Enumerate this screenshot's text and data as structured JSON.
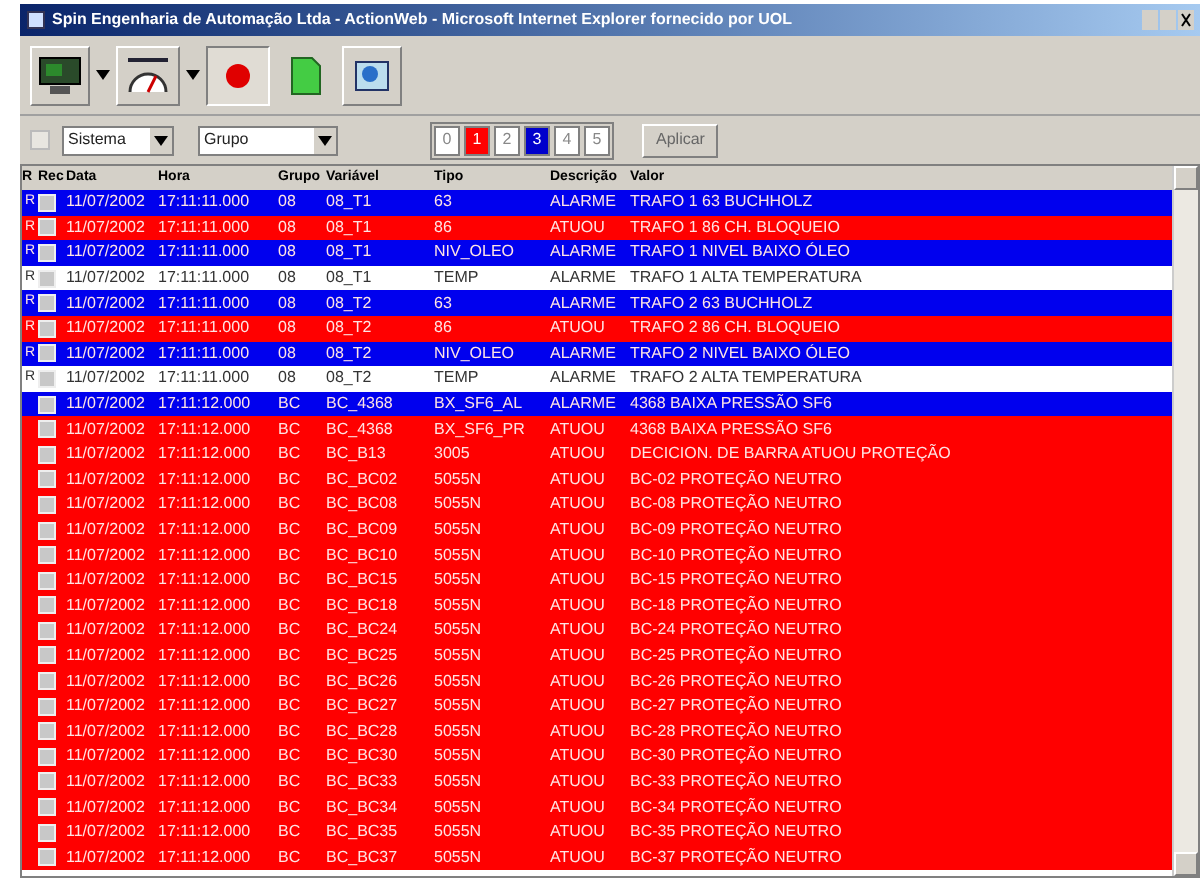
{
  "window": {
    "title": "Spin Engenharia de Automação Ltda - ActionWeb - Microsoft Internet Explorer fornecido por UOL"
  },
  "filters": {
    "checked": false,
    "sistema": "Sistema",
    "grupo": "Grupo",
    "button": "Aplicar"
  },
  "priorities": [
    {
      "label": "0",
      "color": "#ffffff"
    },
    {
      "label": "1",
      "color": "#ff0000"
    },
    {
      "label": "2",
      "color": "#ffffff"
    },
    {
      "label": "3",
      "color": "#0000cc"
    },
    {
      "label": "4",
      "color": "#ffffff"
    },
    {
      "label": "5",
      "color": "#ffffff"
    }
  ],
  "table": {
    "columns": [
      "R",
      "Rec",
      "Data",
      "Hora",
      "Grupo",
      "Variável",
      "Tipo",
      "Descrição",
      "Valor"
    ],
    "rows": [
      {
        "color": "#0000ee",
        "flag": "R",
        "data": "11/07/2002",
        "hora": "17:11:11.000",
        "grupo": "08",
        "variavel": "08_T1",
        "tipo": "63",
        "descricao": "ALARME",
        "valor": "TRAFO 1 63 BUCHHOLZ"
      },
      {
        "color": "#ff0000",
        "flag": "R",
        "data": "11/07/2002",
        "hora": "17:11:11.000",
        "grupo": "08",
        "variavel": "08_T1",
        "tipo": "86",
        "descricao": "ATUOU",
        "valor": "TRAFO 1 86 CH. BLOQUEIO"
      },
      {
        "color": "#0000ee",
        "flag": "R",
        "data": "11/07/2002",
        "hora": "17:11:11.000",
        "grupo": "08",
        "variavel": "08_T1",
        "tipo": "NIV_OLEO",
        "descricao": "ALARME",
        "valor": "TRAFO 1 NIVEL BAIXO ÓLEO"
      },
      {
        "color": "#ffffff",
        "flag": "R",
        "data": "11/07/2002",
        "hora": "17:11:11.000",
        "grupo": "08",
        "variavel": "08_T1",
        "tipo": "TEMP",
        "descricao": "ALARME",
        "valor": "TRAFO 1 ALTA TEMPERATURA"
      },
      {
        "color": "#0000ee",
        "flag": "R",
        "data": "11/07/2002",
        "hora": "17:11:11.000",
        "grupo": "08",
        "variavel": "08_T2",
        "tipo": "63",
        "descricao": "ALARME",
        "valor": "TRAFO 2 63 BUCHHOLZ"
      },
      {
        "color": "#ff0000",
        "flag": "R",
        "data": "11/07/2002",
        "hora": "17:11:11.000",
        "grupo": "08",
        "variavel": "08_T2",
        "tipo": "86",
        "descricao": "ATUOU",
        "valor": "TRAFO 2 86 CH. BLOQUEIO"
      },
      {
        "color": "#0000ee",
        "flag": "R",
        "data": "11/07/2002",
        "hora": "17:11:11.000",
        "grupo": "08",
        "variavel": "08_T2",
        "tipo": "NIV_OLEO",
        "descricao": "ALARME",
        "valor": "TRAFO 2 NIVEL BAIXO ÓLEO"
      },
      {
        "color": "#ffffff",
        "flag": "R",
        "data": "11/07/2002",
        "hora": "17:11:11.000",
        "grupo": "08",
        "variavel": "08_T2",
        "tipo": "TEMP",
        "descricao": "ALARME",
        "valor": "TRAFO 2 ALTA TEMPERATURA"
      },
      {
        "color": "#0000ee",
        "data": "11/07/2002",
        "hora": "17:11:12.000",
        "grupo": "BC",
        "variavel": "BC_4368",
        "tipo": "BX_SF6_AL",
        "descricao": "ALARME",
        "valor": "4368 BAIXA PRESSÃO SF6"
      },
      {
        "color": "#ff0000",
        "data": "11/07/2002",
        "hora": "17:11:12.000",
        "grupo": "BC",
        "variavel": "BC_4368",
        "tipo": "BX_SF6_PR",
        "descricao": "ATUOU",
        "valor": "4368 BAIXA PRESSÃO SF6"
      },
      {
        "color": "#ff0000",
        "data": "11/07/2002",
        "hora": "17:11:12.000",
        "grupo": "BC",
        "variavel": "BC_B13",
        "tipo": "3005",
        "descricao": "ATUOU",
        "valor": "DECICION. DE BARRA ATUOU PROTEÇÃO"
      },
      {
        "color": "#ff0000",
        "data": "11/07/2002",
        "hora": "17:11:12.000",
        "grupo": "BC",
        "variavel": "BC_BC02",
        "tipo": "5055N",
        "descricao": "ATUOU",
        "valor": "BC-02 PROTEÇÃO NEUTRO"
      },
      {
        "color": "#ff0000",
        "data": "11/07/2002",
        "hora": "17:11:12.000",
        "grupo": "BC",
        "variavel": "BC_BC08",
        "tipo": "5055N",
        "descricao": "ATUOU",
        "valor": "BC-08 PROTEÇÃO NEUTRO"
      },
      {
        "color": "#ff0000",
        "data": "11/07/2002",
        "hora": "17:11:12.000",
        "grupo": "BC",
        "variavel": "BC_BC09",
        "tipo": "5055N",
        "descricao": "ATUOU",
        "valor": "BC-09 PROTEÇÃO NEUTRO"
      },
      {
        "color": "#ff0000",
        "data": "11/07/2002",
        "hora": "17:11:12.000",
        "grupo": "BC",
        "variavel": "BC_BC10",
        "tipo": "5055N",
        "descricao": "ATUOU",
        "valor": "BC-10 PROTEÇÃO NEUTRO"
      },
      {
        "color": "#ff0000",
        "data": "11/07/2002",
        "hora": "17:11:12.000",
        "grupo": "BC",
        "variavel": "BC_BC15",
        "tipo": "5055N",
        "descricao": "ATUOU",
        "valor": "BC-15 PROTEÇÃO NEUTRO"
      },
      {
        "color": "#ff0000",
        "data": "11/07/2002",
        "hora": "17:11:12.000",
        "grupo": "BC",
        "variavel": "BC_BC18",
        "tipo": "5055N",
        "descricao": "ATUOU",
        "valor": "BC-18 PROTEÇÃO NEUTRO"
      },
      {
        "color": "#ff0000",
        "data": "11/07/2002",
        "hora": "17:11:12.000",
        "grupo": "BC",
        "variavel": "BC_BC24",
        "tipo": "5055N",
        "descricao": "ATUOU",
        "valor": "BC-24 PROTEÇÃO NEUTRO"
      },
      {
        "color": "#ff0000",
        "data": "11/07/2002",
        "hora": "17:11:12.000",
        "grupo": "BC",
        "variavel": "BC_BC25",
        "tipo": "5055N",
        "descricao": "ATUOU",
        "valor": "BC-25 PROTEÇÃO NEUTRO"
      },
      {
        "color": "#ff0000",
        "data": "11/07/2002",
        "hora": "17:11:12.000",
        "grupo": "BC",
        "variavel": "BC_BC26",
        "tipo": "5055N",
        "descricao": "ATUOU",
        "valor": "BC-26 PROTEÇÃO NEUTRO"
      },
      {
        "color": "#ff0000",
        "data": "11/07/2002",
        "hora": "17:11:12.000",
        "grupo": "BC",
        "variavel": "BC_BC27",
        "tipo": "5055N",
        "descricao": "ATUOU",
        "valor": "BC-27 PROTEÇÃO NEUTRO"
      },
      {
        "color": "#ff0000",
        "data": "11/07/2002",
        "hora": "17:11:12.000",
        "grupo": "BC",
        "variavel": "BC_BC28",
        "tipo": "5055N",
        "descricao": "ATUOU",
        "valor": "BC-28 PROTEÇÃO NEUTRO"
      },
      {
        "color": "#ff0000",
        "data": "11/07/2002",
        "hora": "17:11:12.000",
        "grupo": "BC",
        "variavel": "BC_BC30",
        "tipo": "5055N",
        "descricao": "ATUOU",
        "valor": "BC-30 PROTEÇÃO NEUTRO"
      },
      {
        "color": "#ff0000",
        "data": "11/07/2002",
        "hora": "17:11:12.000",
        "grupo": "BC",
        "variavel": "BC_BC33",
        "tipo": "5055N",
        "descricao": "ATUOU",
        "valor": "BC-33 PROTEÇÃO NEUTRO"
      },
      {
        "color": "#ff0000",
        "data": "11/07/2002",
        "hora": "17:11:12.000",
        "grupo": "BC",
        "variavel": "BC_BC34",
        "tipo": "5055N",
        "descricao": "ATUOU",
        "valor": "BC-34 PROTEÇÃO NEUTRO"
      },
      {
        "color": "#ff0000",
        "data": "11/07/2002",
        "hora": "17:11:12.000",
        "grupo": "BC",
        "variavel": "BC_BC35",
        "tipo": "5055N",
        "descricao": "ATUOU",
        "valor": "BC-35 PROTEÇÃO NEUTRO"
      },
      {
        "color": "#ff0000",
        "data": "11/07/2002",
        "hora": "17:11:12.000",
        "grupo": "BC",
        "variavel": "BC_BC37",
        "tipo": "5055N",
        "descricao": "ATUOU",
        "valor": "BC-37 PROTEÇÃO NEUTRO"
      }
    ]
  }
}
